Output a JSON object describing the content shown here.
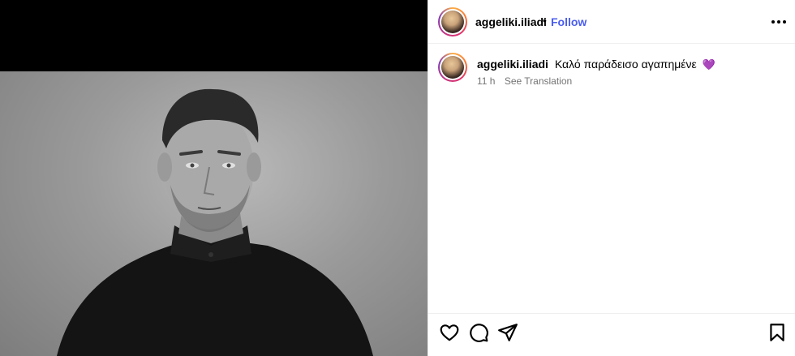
{
  "post": {
    "username": "aggeliki.iliadi",
    "separator": "•",
    "follow_label": "Follow",
    "more_label": "•••"
  },
  "caption": {
    "username": "aggeliki.iliadi",
    "text": "Καλό παράδεισο αγαπημένε",
    "emoji": "💜",
    "time": "11 h",
    "see_translation": "See Translation"
  },
  "icons": {
    "like": "heart-icon",
    "comment": "comment-icon",
    "share": "send-icon",
    "save": "bookmark-icon"
  },
  "colors": {
    "follow": "#4a5df0",
    "muted": "#737373",
    "border": "#efefef"
  }
}
